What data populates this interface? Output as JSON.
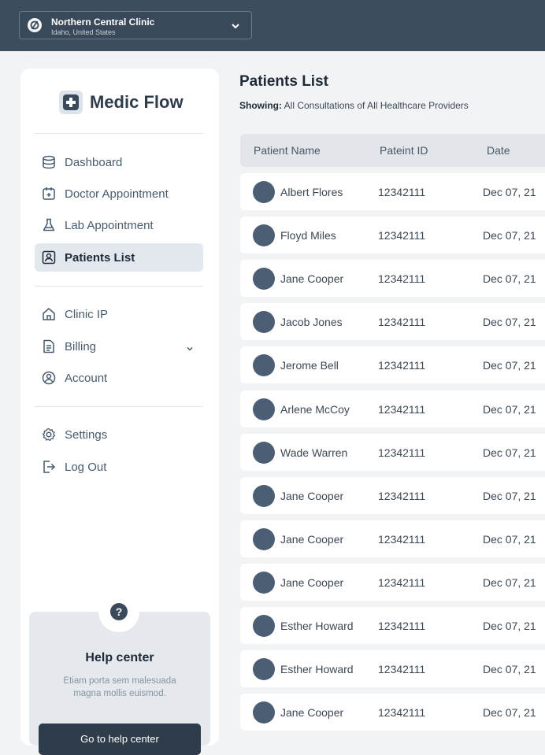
{
  "clinic": {
    "name": "Northern Central Clinic",
    "location": "Idaho, United States"
  },
  "brand": {
    "name": "Medic Flow"
  },
  "nav": {
    "primary": [
      {
        "label": "Dashboard",
        "icon": "database-icon"
      },
      {
        "label": "Doctor Appointment",
        "icon": "calendar-plus-icon"
      },
      {
        "label": "Lab Appointment",
        "icon": "flask-icon"
      },
      {
        "label": "Patients List",
        "icon": "id-badge-icon",
        "active": true
      }
    ],
    "secondary": [
      {
        "label": "Clinic IP",
        "icon": "home-icon"
      },
      {
        "label": "Billing",
        "icon": "document-icon"
      },
      {
        "label": "Account",
        "icon": "user-circle-icon"
      }
    ],
    "tertiary": [
      {
        "label": "Settings",
        "icon": "gear-icon"
      },
      {
        "label": "Log Out",
        "icon": "logout-icon"
      }
    ]
  },
  "help": {
    "title": "Help center",
    "description": "Etiam porta sem malesuada magna mollis euismod.",
    "button_label": "Go to help center"
  },
  "main": {
    "title": "Patients List",
    "showing_label": "Showing:",
    "showing_value": "All Consultations of All Healthcare Providers",
    "columns": [
      "Patient Name",
      "Pateint ID",
      "Date"
    ],
    "rows": [
      {
        "name": "Albert Flores",
        "id": "12342111",
        "date": "Dec 07, 21"
      },
      {
        "name": "Floyd Miles",
        "id": "12342111",
        "date": "Dec 07, 21"
      },
      {
        "name": "Jane Cooper",
        "id": "12342111",
        "date": "Dec 07, 21"
      },
      {
        "name": "Jacob Jones",
        "id": "12342111",
        "date": "Dec 07, 21"
      },
      {
        "name": "Jerome Bell",
        "id": "12342111",
        "date": "Dec 07, 21"
      },
      {
        "name": "Arlene McCoy",
        "id": "12342111",
        "date": "Dec 07, 21"
      },
      {
        "name": "Wade Warren",
        "id": "12342111",
        "date": "Dec 07, 21"
      },
      {
        "name": "Jane Cooper",
        "id": "12342111",
        "date": "Dec 07, 21"
      },
      {
        "name": "Jane Cooper",
        "id": "12342111",
        "date": "Dec 07, 21"
      },
      {
        "name": "Jane Cooper",
        "id": "12342111",
        "date": "Dec 07, 21"
      },
      {
        "name": "Esther Howard",
        "id": "12342111",
        "date": "Dec 07, 21"
      },
      {
        "name": "Esther Howard",
        "id": "12342111",
        "date": "Dec 07, 21"
      },
      {
        "name": "Jane Cooper",
        "id": "12342111",
        "date": "Dec 07, 21"
      }
    ]
  }
}
